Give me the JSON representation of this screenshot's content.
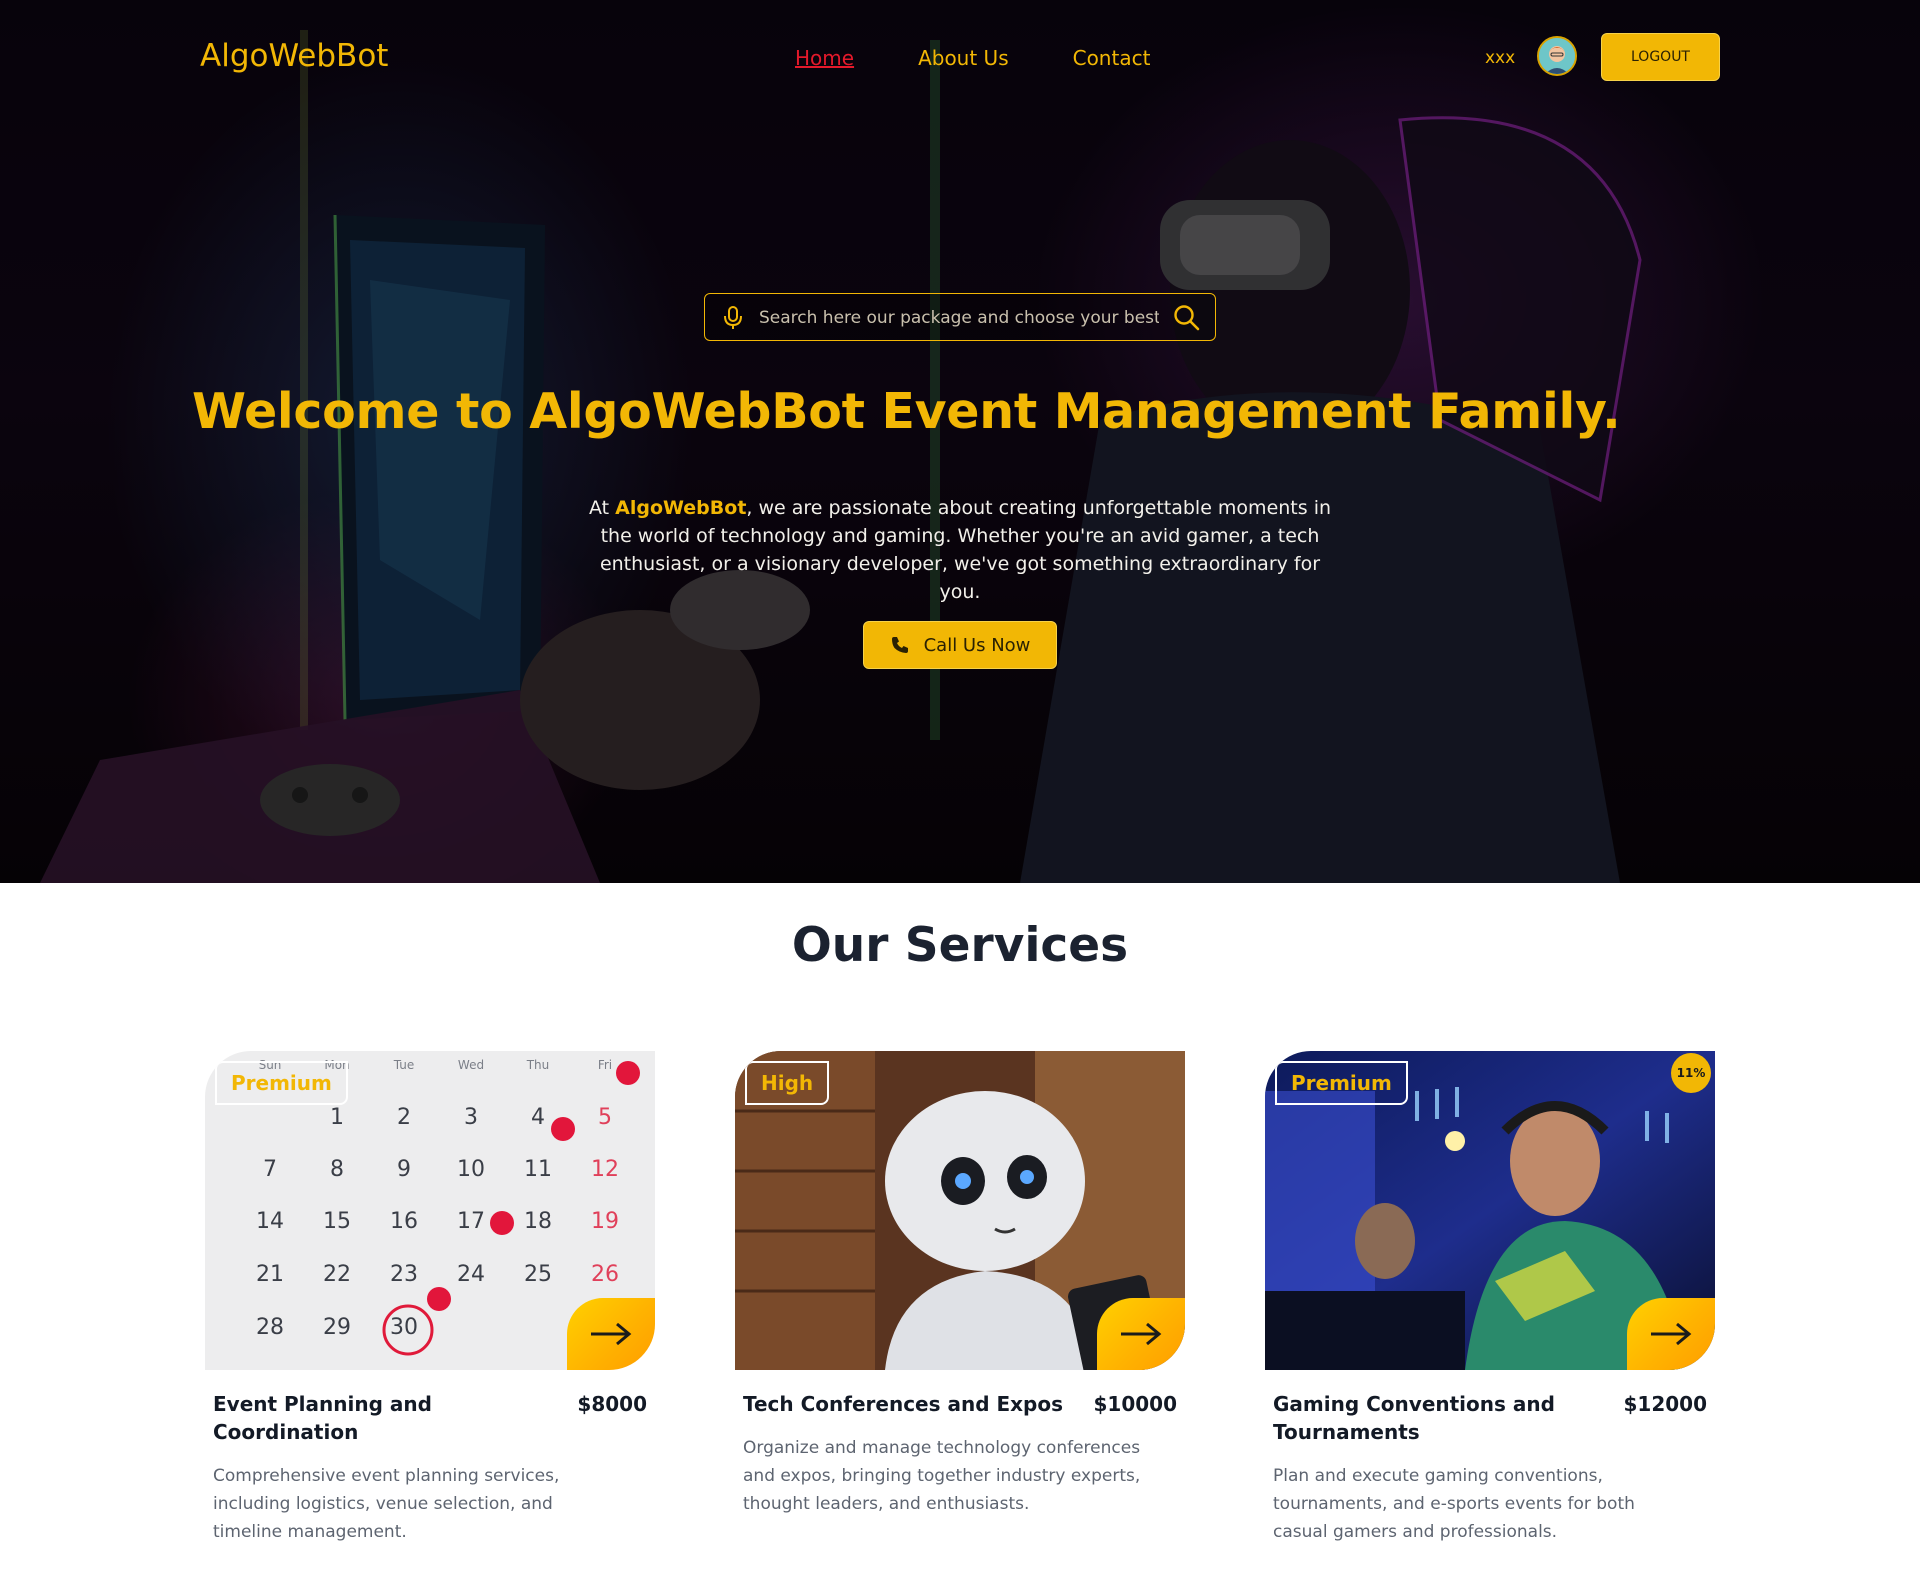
{
  "nav": {
    "logo": "AlgoWebBot",
    "links": [
      {
        "label": "Home",
        "active": true
      },
      {
        "label": "About Us",
        "active": false
      },
      {
        "label": "Contact",
        "active": false
      }
    ],
    "user_name": "xxx",
    "logout_label": "LOGOUT"
  },
  "hero": {
    "search_placeholder": "Search here our package and choose your best",
    "title": "Welcome to AlgoWebBot Event Management Family.",
    "text_prefix": "At ",
    "text_brand": "AlgoWebBot",
    "text_rest": ", we are passionate about creating unforgettable moments in the world of technology and gaming. Whether you're an avid gamer, a tech enthusiast, or a visionary developer, we've got something extraordinary for you.",
    "call_label": "Call Us Now"
  },
  "services": {
    "title": "Our Services",
    "cards": [
      {
        "badge": "Premium",
        "title": "Event Planning and Coordination",
        "price": "$8000",
        "description": "Comprehensive event planning services, including logistics, venue selection, and timeline management.",
        "calendar": {
          "weekdays": [
            "Sun",
            "Mon",
            "Tue",
            "Wed",
            "Thu",
            "Fri"
          ],
          "days": [
            "1",
            "2",
            "3",
            "4",
            "5",
            "7",
            "8",
            "9",
            "10",
            "11",
            "12",
            "14",
            "15",
            "16",
            "17",
            "18",
            "19",
            "21",
            "22",
            "23",
            "24",
            "25",
            "26",
            "28",
            "29",
            "30"
          ]
        }
      },
      {
        "badge": "High",
        "title": "Tech Conferences and Expos",
        "price": "$10000",
        "description": "Organize and manage technology conferences and expos, bringing together industry experts, thought leaders, and enthusiasts."
      },
      {
        "badge": "Premium",
        "discount": "11%",
        "title": "Gaming Conventions and Tournaments",
        "price": "$12000",
        "description": "Plan and execute gaming conventions, tournaments, and e-sports events for both casual gamers and professionals."
      }
    ]
  },
  "colors": {
    "accent": "#f2b705",
    "active_link": "#e3192b",
    "heading": "#1b2230"
  }
}
